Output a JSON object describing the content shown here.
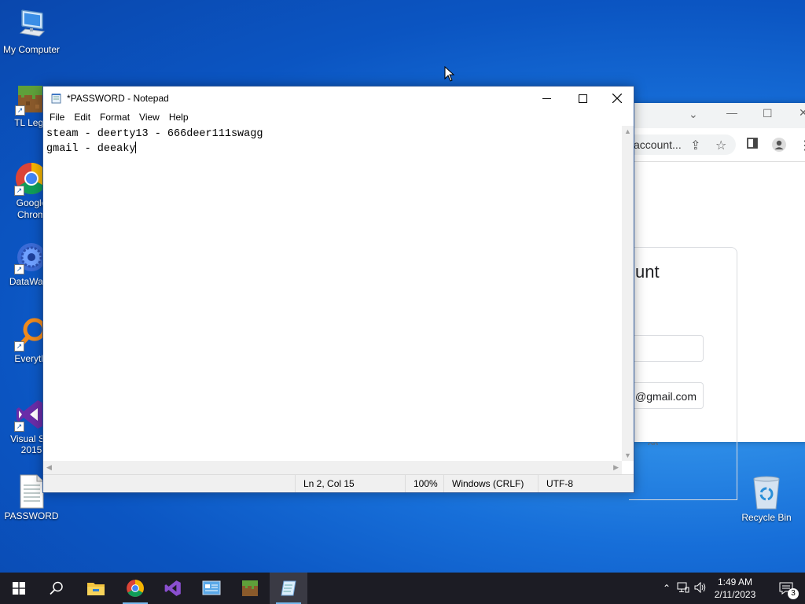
{
  "desktop": {
    "icons": [
      {
        "label": "My Computer",
        "icon": "computer-icon"
      },
      {
        "label": "TL Lega",
        "icon": "minecraft-grass-icon"
      },
      {
        "label": "Google\nChrom",
        "icon": "chrome-icon"
      },
      {
        "label": "DataWago",
        "icon": "datawago-icon"
      },
      {
        "label": "Everythi",
        "icon": "everything-search-icon"
      },
      {
        "label": "Visual Stu\n2015",
        "icon": "visual-studio-icon"
      },
      {
        "label": "PASSWORD",
        "icon": "text-file-icon"
      },
      {
        "label": "Recycle Bin",
        "icon": "recycle-bin-icon"
      }
    ]
  },
  "browser": {
    "omnibox_text": "account...",
    "card_title": "unt",
    "email_suffix": "@gmail.com",
    "partial_text": "on"
  },
  "notepad": {
    "title": "*PASSWORD - Notepad",
    "menu": [
      "File",
      "Edit",
      "Format",
      "View",
      "Help"
    ],
    "lines": [
      "steam - deerty13 - 666deer111swagg",
      "gmail - deeaky"
    ],
    "status": {
      "position": "Ln 2, Col 15",
      "zoom": "100%",
      "line_ending": "Windows (CRLF)",
      "encoding": "UTF-8"
    }
  },
  "taskbar": {
    "apps": [
      "start-icon",
      "search-icon",
      "file-explorer-icon",
      "chrome-icon",
      "visual-studio-icon",
      "control-panel-icon",
      "minecraft-icon",
      "notepad-icon"
    ],
    "time": "1:49 AM",
    "date": "2/11/2023",
    "notification_count": "3"
  },
  "colors": {
    "taskbar_bg": "#1c1c24",
    "accent": "#76b9ed",
    "vs_purple": "#7b3fb3"
  }
}
